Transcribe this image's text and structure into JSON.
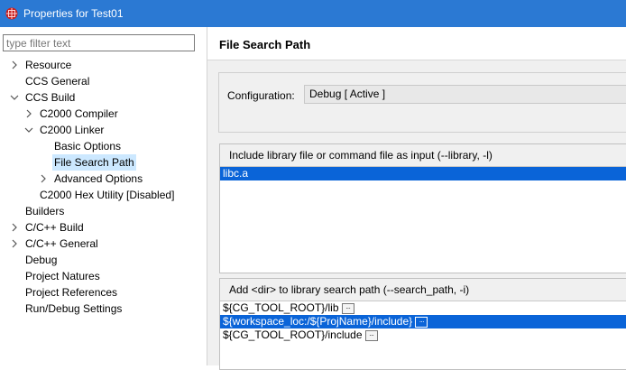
{
  "window": {
    "title": "Properties for Test01"
  },
  "filter": {
    "placeholder": "type filter text",
    "value": ""
  },
  "tree": [
    {
      "label": "Resource",
      "level": 0,
      "twisty": "collapsed",
      "selected": false
    },
    {
      "label": "CCS General",
      "level": 0,
      "twisty": "none",
      "selected": false
    },
    {
      "label": "CCS Build",
      "level": 0,
      "twisty": "expanded",
      "selected": false
    },
    {
      "label": "C2000 Compiler",
      "level": 1,
      "twisty": "collapsed",
      "selected": false
    },
    {
      "label": "C2000 Linker",
      "level": 1,
      "twisty": "expanded",
      "selected": false
    },
    {
      "label": "Basic Options",
      "level": 2,
      "twisty": "none",
      "selected": false
    },
    {
      "label": "File Search Path",
      "level": 2,
      "twisty": "none",
      "selected": true
    },
    {
      "label": "Advanced Options",
      "level": 2,
      "twisty": "collapsed",
      "selected": false
    },
    {
      "label": "C2000 Hex Utility  [Disabled]",
      "level": 1,
      "twisty": "none",
      "selected": false
    },
    {
      "label": "Builders",
      "level": 0,
      "twisty": "none",
      "selected": false
    },
    {
      "label": "C/C++ Build",
      "level": 0,
      "twisty": "collapsed",
      "selected": false
    },
    {
      "label": "C/C++ General",
      "level": 0,
      "twisty": "collapsed",
      "selected": false
    },
    {
      "label": "Debug",
      "level": 0,
      "twisty": "none",
      "selected": false
    },
    {
      "label": "Project Natures",
      "level": 0,
      "twisty": "none",
      "selected": false
    },
    {
      "label": "Project References",
      "level": 0,
      "twisty": "none",
      "selected": false
    },
    {
      "label": "Run/Debug Settings",
      "level": 0,
      "twisty": "none",
      "selected": false
    }
  ],
  "page": {
    "title": "File Search Path",
    "configuration_label": "Configuration:",
    "configuration_value": "Debug  [ Active ]"
  },
  "library_group": {
    "header": "Include library file or command file as input (--library, -l)",
    "items": [
      {
        "text": "libc.a",
        "selected": true,
        "has_var_button": false
      }
    ]
  },
  "search_path_group": {
    "header": "Add <dir> to library search path (--search_path, -i)",
    "items": [
      {
        "text": "${CG_TOOL_ROOT}/lib",
        "selected": false,
        "has_var_button": true
      },
      {
        "text": "${workspace_loc:/${ProjName}/include}",
        "selected": true,
        "has_var_button": true
      },
      {
        "text": "${CG_TOOL_ROOT}/include",
        "selected": false,
        "has_var_button": true
      }
    ]
  },
  "icons": {
    "app": "ccs-app-icon",
    "collapsed": "chevron-right-icon",
    "expanded": "chevron-down-icon",
    "variable": "variable-ellipsis-icon"
  },
  "colors": {
    "title_bar": "#2b79d3",
    "tree_selection": "#cce8ff",
    "list_selection": "#0a64d8"
  }
}
